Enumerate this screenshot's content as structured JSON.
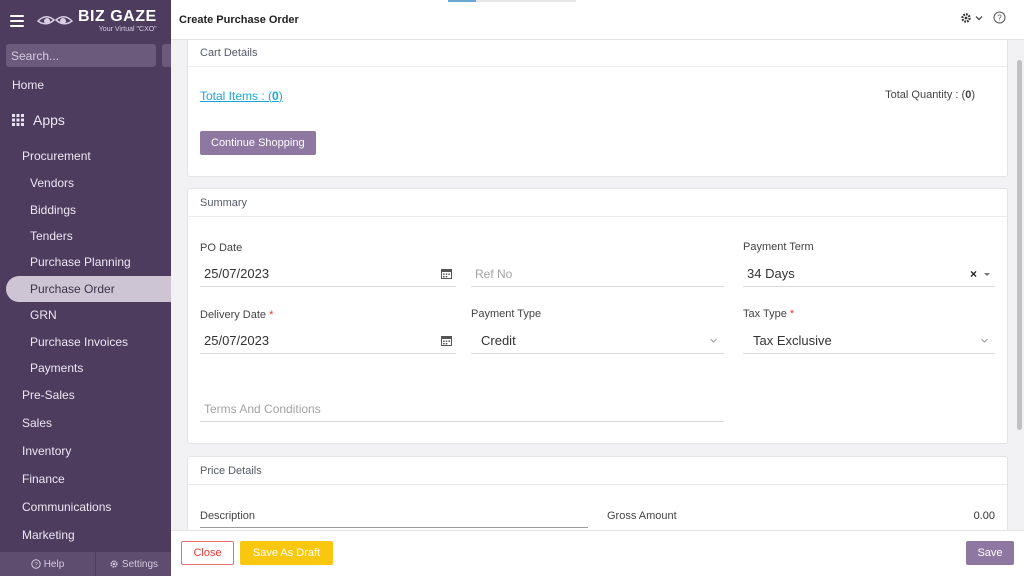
{
  "app": {
    "logo_name": "BIZ GAZE",
    "logo_tagline": "Your Virtual \"CXO\""
  },
  "sidebar": {
    "search_placeholder": "Search...",
    "home": "Home",
    "apps": "Apps",
    "items": [
      {
        "label": "Procurement",
        "level": 1
      },
      {
        "label": "Vendors",
        "level": 2
      },
      {
        "label": "Biddings",
        "level": 2
      },
      {
        "label": "Tenders",
        "level": 2
      },
      {
        "label": "Purchase Planning",
        "level": 2
      },
      {
        "label": "Purchase Order",
        "level": 2,
        "active": true
      },
      {
        "label": "GRN",
        "level": 2
      },
      {
        "label": "Purchase Invoices",
        "level": 2
      },
      {
        "label": "Payments",
        "level": 2
      },
      {
        "label": "Pre-Sales",
        "level": 1
      },
      {
        "label": "Sales",
        "level": 1
      },
      {
        "label": "Inventory",
        "level": 1
      },
      {
        "label": "Finance",
        "level": 1
      },
      {
        "label": "Communications",
        "level": 1
      },
      {
        "label": "Marketing",
        "level": 1
      }
    ],
    "help_label": "Help",
    "settings_label": "Settings"
  },
  "header": {
    "title": "Create Purchase Order"
  },
  "cart": {
    "title": "Cart Details",
    "total_items_prefix": "Total Items : (",
    "total_items_value": "0",
    "total_items_suffix": ")",
    "total_quantity_prefix": "Total Quantity : (",
    "total_quantity_value": "0",
    "total_quantity_suffix": ")",
    "continue_label": "Continue Shopping"
  },
  "summary": {
    "title": "Summary",
    "po_date_label": "PO Date",
    "po_date_value": "25/07/2023",
    "ref_no_placeholder": "Ref No",
    "payment_term_label": "Payment Term",
    "payment_term_value": "34 Days",
    "delivery_date_label": "Delivery Date",
    "delivery_date_value": "25/07/2023",
    "payment_type_label": "Payment Type",
    "payment_type_value": "Credit",
    "tax_type_label": "Tax Type",
    "tax_type_value": "Tax Exclusive",
    "terms_placeholder": "Terms And Conditions",
    "required_mark": "*"
  },
  "price": {
    "title": "Price Details",
    "description_label": "Description",
    "gross_amount_label": "Gross Amount",
    "gross_amount_value": "0.00"
  },
  "footer": {
    "close_label": "Close",
    "draft_label": "Save As Draft",
    "save_label": "Save"
  },
  "colors": {
    "sidebar_bg": "#4d3c5d",
    "accent_purple": "#8e78a2",
    "link_blue": "#19a7d8",
    "draft_yellow": "#f9c80e",
    "close_red": "#e53935"
  }
}
